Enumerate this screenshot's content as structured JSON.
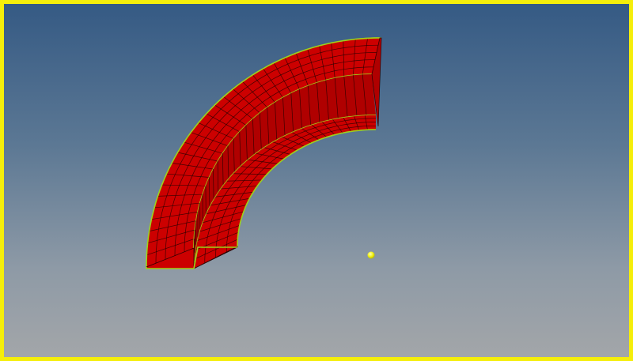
{
  "viewport": {
    "background_top": "#355a84",
    "background_bottom": "#a3a6a9",
    "frame_color": "#f5ee0a"
  },
  "model": {
    "element_color": "#cc0000",
    "side_color": "#b00000",
    "mesh_line_color": "#2a0000",
    "edge_color": "#9ed21a"
  },
  "marker": {
    "icon": "sphere-marker-icon",
    "color": "#f3f312"
  }
}
